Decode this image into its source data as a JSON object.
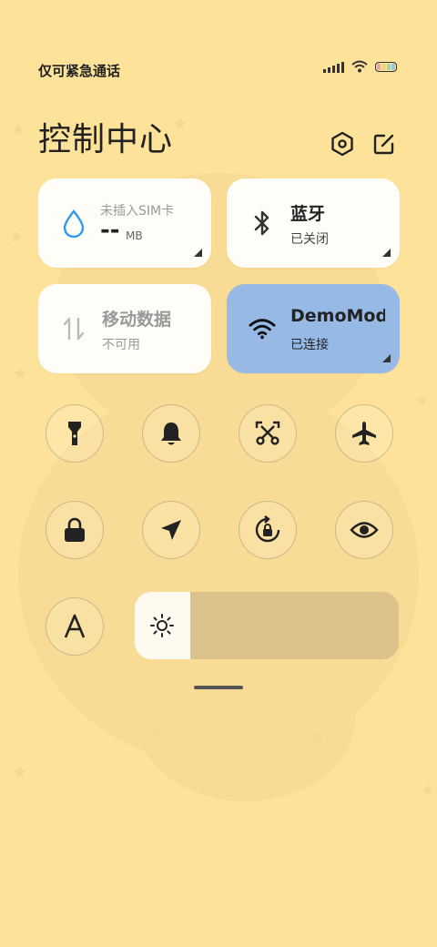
{
  "status": {
    "carrier_text": "仅可紧急通话"
  },
  "header": {
    "title": "控制中心"
  },
  "tiles": {
    "data_usage": {
      "title": "未插入SIM卡",
      "value": "--",
      "unit": "MB"
    },
    "bluetooth": {
      "title": "蓝牙",
      "status": "已关闭"
    },
    "mobile_data": {
      "title": "移动数据",
      "status": "不可用"
    },
    "wifi": {
      "title": "DemoMod",
      "status": "已连接"
    }
  },
  "toggles": [
    {
      "name": "flashlight",
      "icon": "flashlight-icon"
    },
    {
      "name": "mute",
      "icon": "bell-icon"
    },
    {
      "name": "screenshot",
      "icon": "scissors-icon"
    },
    {
      "name": "airplane-mode",
      "icon": "airplane-icon"
    },
    {
      "name": "lock-screen",
      "icon": "lock-icon"
    },
    {
      "name": "location",
      "icon": "location-arrow-icon"
    },
    {
      "name": "rotation-lock",
      "icon": "rotation-lock-icon"
    },
    {
      "name": "reading-mode",
      "icon": "eye-icon"
    }
  ],
  "controls": {
    "auto_brightness_icon": "letter-a-icon",
    "brightness_icon": "sun-icon",
    "brightness_level": 0.21
  },
  "colors": {
    "background": "#fde39a",
    "tile_bg": "#fffdf8",
    "active_tile": "#97b9e6",
    "accent_blue": "#2e9bf0"
  }
}
